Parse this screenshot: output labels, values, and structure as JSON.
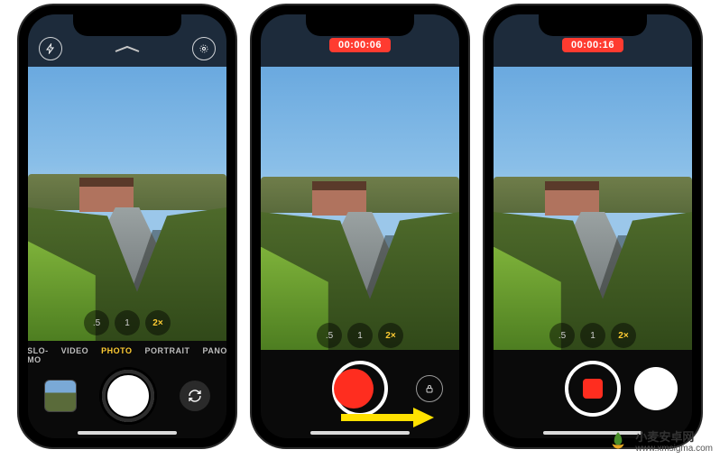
{
  "phones": [
    {
      "state": "photo",
      "zoom": {
        "options": [
          ".5",
          "1",
          "2×"
        ],
        "active_index": 2
      },
      "modes": {
        "items": [
          "SLO-MO",
          "VIDEO",
          "PHOTO",
          "PORTRAIT",
          "PANO"
        ],
        "active_index": 2
      }
    },
    {
      "state": "recording-drag",
      "timer": "00:00:06",
      "zoom": {
        "options": [
          ".5",
          "1",
          "2×"
        ],
        "active_index": 2
      }
    },
    {
      "state": "recording-locked",
      "timer": "00:00:16",
      "zoom": {
        "options": [
          ".5",
          "1",
          "2×"
        ],
        "active_index": 2
      }
    }
  ],
  "watermark": {
    "name": "小麦安卓网",
    "url": "www.xmsigma.com"
  }
}
